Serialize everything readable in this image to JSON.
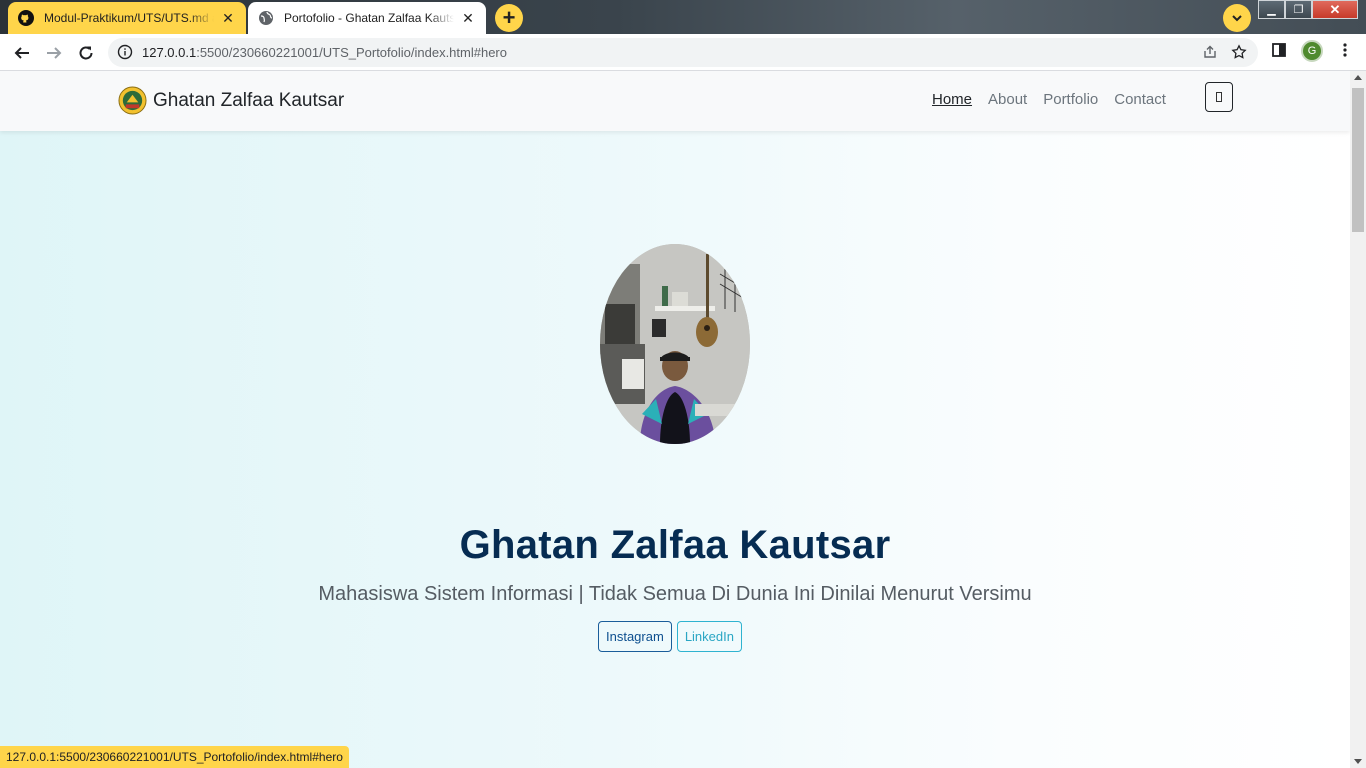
{
  "browser": {
    "tabs": [
      {
        "title": "Modul-Praktikum/UTS/UTS.md at",
        "favicon": "github-icon",
        "active": false
      },
      {
        "title": "Portofolio - Ghatan Zalfaa Kautsar",
        "favicon": "globe-icon",
        "active": true
      }
    ],
    "new_tab_label": "+",
    "address": {
      "host": "127.0.0.1",
      "rest": ":5500/230660221001/UTS_Portofolio/index.html#hero"
    },
    "profile_initial": "G",
    "status_url": "127.0.0.1:5500/230660221001/UTS_Portofolio/index.html#hero",
    "accent": "#ffd54a"
  },
  "site": {
    "brand": "Ghatan Zalfaa Kautsar",
    "nav": [
      {
        "label": "Home",
        "active": true
      },
      {
        "label": "About",
        "active": false
      },
      {
        "label": "Portfolio",
        "active": false
      },
      {
        "label": "Contact",
        "active": false
      }
    ],
    "hero": {
      "name": "Ghatan Zalfaa Kautsar",
      "tagline": "Mahasiswa Sistem Informasi | Tidak Semua Di Dunia Ini Dinilai Menurut Versimu",
      "buttons": {
        "instagram": "Instagram",
        "linkedin": "LinkedIn"
      }
    },
    "colors": {
      "name": "#062c52",
      "nav_bg": "#f8f9fa",
      "hero_bg_start": "#dff5f7"
    }
  }
}
